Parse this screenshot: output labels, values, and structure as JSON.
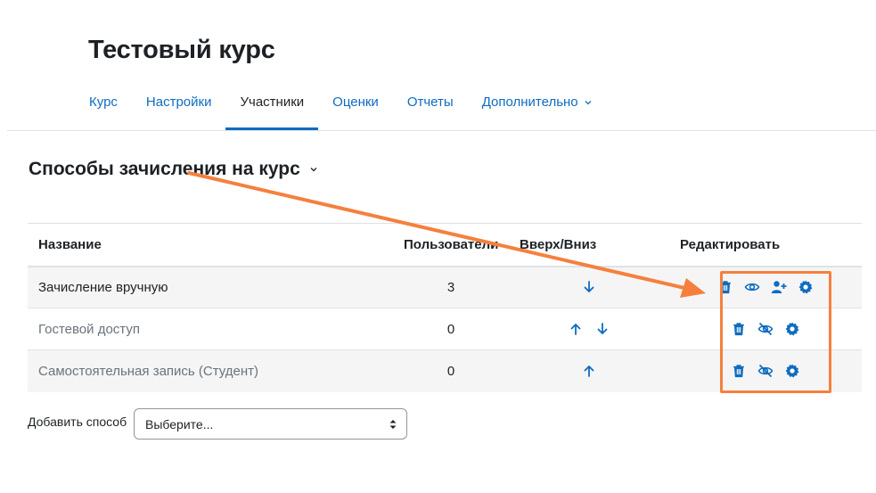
{
  "course": {
    "title": "Тестовый курс"
  },
  "nav": {
    "tabs": [
      {
        "label": "Курс"
      },
      {
        "label": "Настройки"
      },
      {
        "label": "Участники",
        "active": true
      },
      {
        "label": "Оценки"
      },
      {
        "label": "Отчеты"
      },
      {
        "label": "Дополнительно",
        "has_dropdown": true
      }
    ]
  },
  "section": {
    "title": "Способы зачисления на курс"
  },
  "table": {
    "headers": {
      "name": "Название",
      "users": "Пользователи",
      "updown": "Вверх/Вниз",
      "edit": "Редактировать"
    },
    "rows": [
      {
        "name": "Зачисление вручную",
        "users": "3",
        "moves": [
          "down"
        ],
        "edit_icons": [
          "trash-icon",
          "eye-icon",
          "enrol-user-icon",
          "gear-icon"
        ]
      },
      {
        "name": "Гостевой доступ",
        "users": "0",
        "moves": [
          "up",
          "down"
        ],
        "edit_icons": [
          "trash-icon",
          "eye-slash-icon",
          "gear-icon"
        ]
      },
      {
        "name": "Самостоятельная запись (Студент)",
        "users": "0",
        "moves": [
          "up"
        ],
        "edit_icons": [
          "trash-icon",
          "eye-slash-icon",
          "gear-icon"
        ]
      }
    ]
  },
  "add_method": {
    "label": "Добавить способ",
    "select_value": "Выберите..."
  },
  "colors": {
    "link": "#0f6cbf",
    "annotation": "#f5803e",
    "text": "#1d2125",
    "muted": "#6a737b"
  }
}
